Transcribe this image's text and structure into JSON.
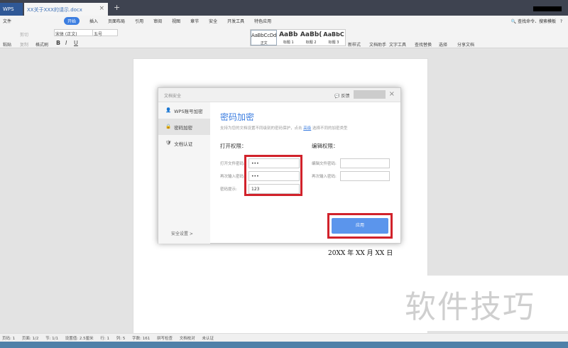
{
  "titlebar": {
    "app_tab": "WPS",
    "doc_tab": "XX关于XXX的请示.docx",
    "close": "×",
    "new_tab": "+",
    "window_controls": "– □ ×"
  },
  "menu": {
    "items": [
      "文件",
      "插入",
      "页面布局",
      "引用",
      "审阅",
      "视图",
      "章节",
      "安全",
      "开发工具",
      "特色应用"
    ],
    "active": "开始",
    "search": "查找命令、搜索模板",
    "help": "?"
  },
  "toolbar": {
    "paste": "粘贴",
    "cut": "剪切",
    "copy": "复制",
    "format_painter": "格式刷",
    "font": "宋体 (正文)",
    "size": "五号",
    "bold": "B",
    "italic": "I",
    "underline": "U",
    "styles": [
      {
        "sample": "AaBbCcDd",
        "name": "正文"
      },
      {
        "sample": "AaBb",
        "name": "标题 1"
      },
      {
        "sample": "AaBb(",
        "name": "标题 2"
      },
      {
        "sample": "AaBbC",
        "name": "标题 3"
      }
    ],
    "new_style": "新样式",
    "doc_assistant": "文档助手",
    "text_tools": "文字工具",
    "find_replace": "查找替换",
    "select": "选择",
    "share": "分享文档"
  },
  "dialog": {
    "title": "文档安全",
    "feedback": "反馈",
    "close": "×",
    "side": [
      {
        "label": "WPS账号加密",
        "icon": "user-icon"
      },
      {
        "label": "密码加密",
        "icon": "lock-icon"
      },
      {
        "label": "文档认证",
        "icon": "shield-icon"
      }
    ],
    "security_settings": "安全设置 >",
    "heading": "密码加密",
    "desc": "支持为您的文档设置不同级别的密码保护，点击",
    "link": "高级",
    "desc2": "选择不同的加密类型",
    "open_perm": "打开权限：",
    "edit_perm": "编辑权限：",
    "open_pwd_label": "打开文件密码:",
    "open_pwd": "•••",
    "confirm_label": "再次输入密码:",
    "confirm_pwd": "•••",
    "hint_label": "密码提示:",
    "hint": "123",
    "edit_pwd_label": "编辑文件密码:",
    "edit_confirm_label": "再次输入密码:",
    "apply": "应用"
  },
  "document": {
    "date": "20XX 年 XX 月 XX 日"
  },
  "watermark": "软件技巧",
  "status": [
    "页码: 1",
    "页面: 1/2",
    "节: 1/1",
    "设置值: 2.5厘米",
    "行: 1",
    "列: 5",
    "字数: 161",
    "拼写检查",
    "文档校对",
    "未认证"
  ]
}
